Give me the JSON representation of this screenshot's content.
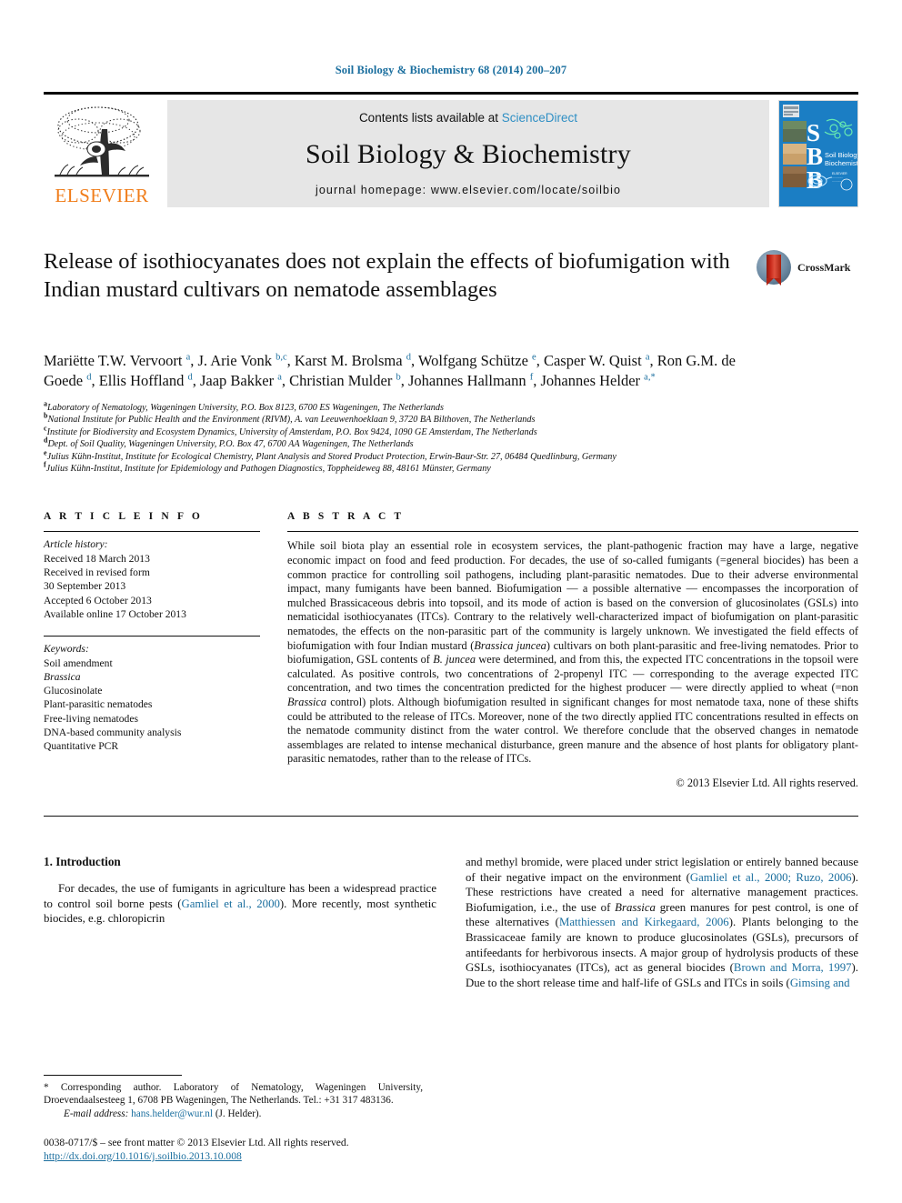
{
  "running_head": "Soil Biology & Biochemistry 68 (2014) 200–207",
  "masthead": {
    "contents_prefix": "Contents lists available at ",
    "sciencedirect": "ScienceDirect",
    "journal_title": "Soil Biology & Biochemistry",
    "homepage": "journal homepage: www.elsevier.com/locate/soilbio",
    "publisher_name": "ELSEVIER",
    "cover_initials": "S B B",
    "cover_journal_name": "Soil Biology & Biochemistry",
    "link_color": "#2f8fc4",
    "accent_color": "#1a6e9e",
    "publisher_color": "#f07d1a"
  },
  "article": {
    "title": "Release of isothiocyanates does not explain the effects of biofumigation with Indian mustard cultivars on nematode assemblages",
    "crossmark_label": "CrossMark",
    "authors_html": "Mariëtte T.W. Vervoort <sup>a</sup>, J. Arie Vonk <sup>b,c</sup>, Karst M. Brolsma <sup>d</sup>, Wolfgang Schütze <sup>e</sup>, Casper W. Quist <sup>a</sup>, Ron G.M. de Goede <sup>d</sup>, Ellis Hoffland <sup>d</sup>, Jaap Bakker <sup>a</sup>, Christian Mulder <sup>b</sup>, Johannes Hallmann <sup>f</sup>, Johannes Helder <sup>a,</sup><sup>*</sup>",
    "affiliations": [
      {
        "mark": "a",
        "text": "Laboratory of Nematology, Wageningen University, P.O. Box 8123, 6700 ES Wageningen, The Netherlands"
      },
      {
        "mark": "b",
        "text": "National Institute for Public Health and the Environment (RIVM), A. van Leeuwenhoeklaan 9, 3720 BA Bilthoven, The Netherlands"
      },
      {
        "mark": "c",
        "text": "Institute for Biodiversity and Ecosystem Dynamics, University of Amsterdam, P.O. Box 9424, 1090 GE Amsterdam, The Netherlands"
      },
      {
        "mark": "d",
        "text": "Dept. of Soil Quality, Wageningen University, P.O. Box 47, 6700 AA Wageningen, The Netherlands"
      },
      {
        "mark": "e",
        "text": "Julius Kühn-Institut, Institute for Ecological Chemistry, Plant Analysis and Stored Product Protection, Erwin-Baur-Str. 27, 06484 Quedlinburg, Germany"
      },
      {
        "mark": "f",
        "text": "Julius Kühn-Institut, Institute for Epidemiology and Pathogen Diagnostics, Toppheideweg 88, 48161 Münster, Germany"
      }
    ]
  },
  "article_info": {
    "heading": "A R T I C L E  I N F O",
    "history_label": "Article history:",
    "history": [
      "Received 18 March 2013",
      "Received in revised form",
      "30 September 2013",
      "Accepted 6 October 2013",
      "Available online 17 October 2013"
    ],
    "keywords_label": "Keywords:",
    "keywords": [
      "Soil amendment",
      "Brassica",
      "Glucosinolate",
      "Plant-parasitic nematodes",
      "Free-living nematodes",
      "DNA-based community analysis",
      "Quantitative PCR"
    ],
    "italic_keywords": [
      "Brassica"
    ]
  },
  "abstract": {
    "heading": "A B S T R A C T",
    "text_html": "While soil biota play an essential role in ecosystem services, the plant-pathogenic fraction may have a large, negative economic impact on food and feed production. For decades, the use of so-called fumigants (=general biocides) has been a common practice for controlling soil pathogens, including plant-parasitic nematodes. Due to their adverse environmental impact, many fumigants have been banned. Biofumigation &#8212; a possible alternative &#8212; encompasses the incorporation of mulched Brassicaceous debris into topsoil, and its mode of action is based on the conversion of glucosinolates (GSLs) into nematicidal isothiocyanates (ITCs). Contrary to the relatively well-characterized impact of biofumigation on plant-parasitic nematodes, the effects on the non-parasitic part of the community is largely unknown. We investigated the field effects of biofumigation with four Indian mustard (<span class=\"it\">Brassica juncea</span>) cultivars on both plant-parasitic and free-living nematodes. Prior to biofumigation, GSL contents of <span class=\"it\">B. juncea</span> were determined, and from this, the expected ITC concentrations in the topsoil were calculated. As positive controls, two concentrations of 2-propenyl ITC &#8212; corresponding to the average expected ITC concentration, and two times the concentration predicted for the highest producer &#8212; were directly applied to wheat (=non <span class=\"it\">Brassica</span> control) plots. Although biofumigation resulted in significant changes for most nematode taxa, none of these shifts could be attributed to the release of ITCs. Moreover, none of the two directly applied ITC concentrations resulted in effects on the nematode community distinct from the water control. We therefore conclude that the observed changes in nematode assemblages are related to intense mechanical disturbance, green manure and the absence of host plants for obligatory plant-parasitic nematodes, rather than to the release of ITCs.",
    "copyright": "© 2013 Elsevier Ltd. All rights reserved."
  },
  "introduction": {
    "heading": "1. Introduction",
    "left_html": "For decades, the use of fumigants in agriculture has been a widespread practice to control soil borne pests (<span class=\"ref\">Gamliel et al., 2000</span>). More recently, most synthetic biocides, e.g. chloropicrin",
    "right_html": "and methyl bromide, were placed under strict legislation or entirely banned because of their negative impact on the environment (<span class=\"ref\">Gamliel et al., 2000; Ruzo, 2006</span>). These restrictions have created a need for alternative management practices. Biofumigation, i.e., the use of <span class=\"it\">Brassica</span> green manures for pest control, is one of these alternatives (<span class=\"ref\">Matthiessen and Kirkegaard, 2006</span>). Plants belonging to the Brassicaceae family are known to produce glucosinolates (GSLs), precursors of antifeedants for herbivorous insects. A major group of hydrolysis products of these GSLs, isothiocyanates (ITCs), act as general biocides (<span class=\"ref\">Brown and Morra, 1997</span>). Due to the short release time and half-life of GSLs and ITCs in soils (<span class=\"ref\">Gimsing and</span>"
  },
  "footnote": {
    "corresponding_html": "* Corresponding author. Laboratory of Nematology, Wageningen University, Droevendaalsesteeg 1, 6708 PB Wageningen, The Netherlands. Tel.: +31 317 483136.",
    "email_label": "E-mail address:",
    "email": "hans.helder@wur.nl",
    "email_suffix": " (J. Helder).",
    "issn_line": "0038-0717/$ – see front matter © 2013 Elsevier Ltd. All rights reserved.",
    "doi": "http://dx.doi.org/10.1016/j.soilbio.2013.10.008"
  }
}
